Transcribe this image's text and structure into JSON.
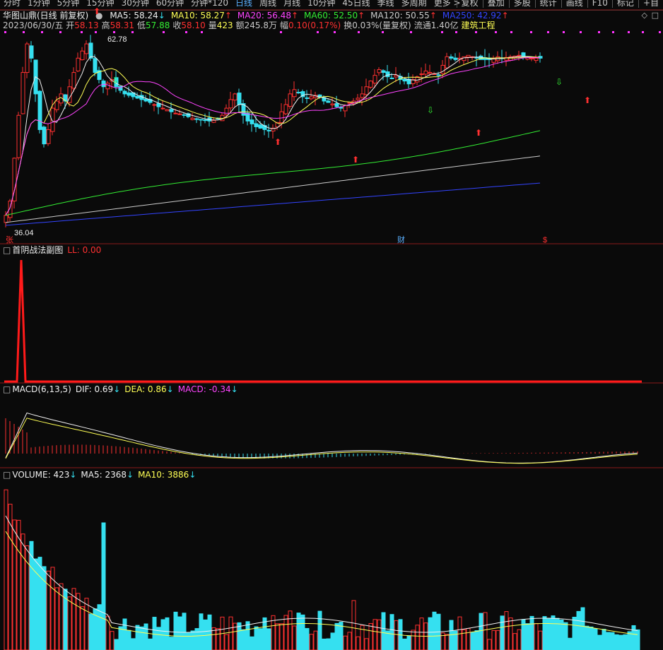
{
  "toolbar": {
    "left_items": [
      "分时",
      "1分钟",
      "5分钟",
      "15分钟",
      "30分钟",
      "60分钟",
      "分钟*120",
      "日线",
      "周线",
      "月线",
      "10分钟",
      "45日线",
      "季线",
      "多周期",
      "更多 >"
    ],
    "active_item": "日线",
    "right_items": [
      "复权",
      "叠加",
      "多股",
      "统计",
      "画线",
      "F10",
      "标记",
      "+自"
    ]
  },
  "main": {
    "title": "华图山鼎(日线 前复权)",
    "ma": [
      {
        "label": "MA5: 58.24",
        "dir": "↓",
        "color": "#f0f0f0"
      },
      {
        "label": "MA10: 58.27",
        "dir": "↑",
        "color": "#ffff55"
      },
      {
        "label": "MA20: 56.48",
        "dir": "↑",
        "color": "#ff44ff"
      },
      {
        "label": "MA60: 52.50",
        "dir": "↑",
        "color": "#33ee33"
      },
      {
        "label": "MA120: 50.55",
        "dir": "↑",
        "color": "#cccccc"
      },
      {
        "label": "MA250: 42.92",
        "dir": "↑",
        "color": "#3344ff"
      }
    ],
    "quote": {
      "date": "2023/06/30/五",
      "open_label": "开",
      "open": "58.13",
      "high_label": "高",
      "high": "58.31",
      "low_label": "低",
      "low": "57.88",
      "close_label": "收",
      "close": "58.10",
      "vol_label": "量",
      "vol": "423",
      "amt_label": "额",
      "amt": "245.8万",
      "chg_label": "幅",
      "chg": "0.10(0.17%)",
      "turn": "换0.03%(量复权)",
      "float": "流通1.40亿",
      "industry": "建筑工程"
    },
    "price_high": "62.78",
    "price_low": "36.04",
    "markers": [
      "张",
      "财",
      "$"
    ]
  },
  "sub1": {
    "title": "首阴战法副图",
    "value": "LL: 0.00"
  },
  "macd": {
    "title": "MACD(6,13,5)",
    "dif": "DIF: 0.69",
    "dea": "DEA: 0.86",
    "macd": "MACD: -0.34"
  },
  "volume": {
    "title": "VOLUME: 423",
    "ma5": "MA5: 2368",
    "ma10": "MA10: 3886"
  },
  "colors": {
    "up": "#ff3030",
    "down": "#35e0f0",
    "ma5": "#f0f0f0",
    "ma10": "#ffff55",
    "ma20": "#ff44ff",
    "ma60": "#33ee33",
    "ma120": "#cccccc",
    "ma250": "#3344ff"
  }
}
